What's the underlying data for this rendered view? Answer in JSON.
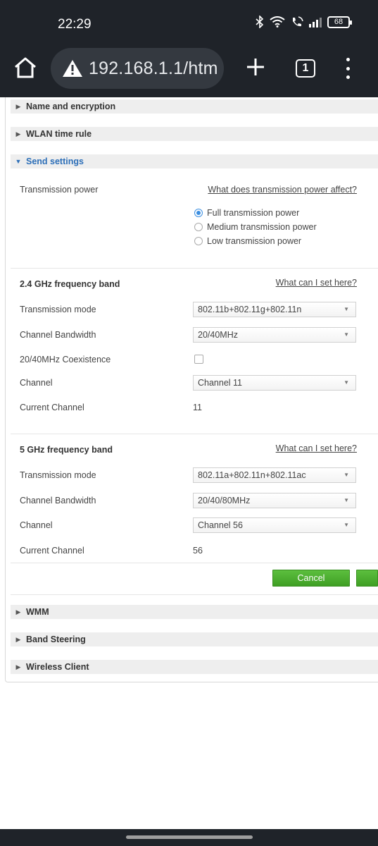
{
  "status_bar": {
    "time": "22:29",
    "battery": "68",
    "icons": [
      "bluetooth-icon",
      "wifi-icon",
      "volte-call-icon",
      "signal-icon",
      "battery-icon"
    ]
  },
  "browser": {
    "url": "192.168.1.1/htm",
    "tab_count": "1",
    "icons": [
      "home-icon",
      "warning-icon",
      "plus-icon",
      "tab-switcher-icon",
      "more-vert-icon"
    ]
  },
  "sections": {
    "name_encryption": "Name and encryption",
    "wlan_time_rule": "WLAN time rule",
    "send_settings": "Send settings",
    "wmm": "WMM",
    "band_steering": "Band Steering",
    "wireless_client": "Wireless Client"
  },
  "send_settings": {
    "transmission_power_label": "Transmission power",
    "transmission_power_link": "What does transmission power affect?",
    "power_options": [
      {
        "label": "Full transmission power",
        "selected": true
      },
      {
        "label": "Medium transmission power",
        "selected": false
      },
      {
        "label": "Low transmission power",
        "selected": false
      }
    ]
  },
  "band_24": {
    "title": "2.4 GHz frequency band",
    "help_link": "What can I set here?",
    "mode_label": "Transmission mode",
    "mode_value": "802.11b+802.11g+802.11n",
    "bandwidth_label": "Channel Bandwidth",
    "bandwidth_value": "20/40MHz",
    "coexistence_label": "20/40MHz Coexistence",
    "coexistence_checked": false,
    "channel_label": "Channel",
    "channel_value": "Channel 11",
    "current_channel_label": "Current Channel",
    "current_channel_value": "11"
  },
  "band_5": {
    "title": "5 GHz frequency band",
    "help_link": "What can I set here?",
    "mode_label": "Transmission mode",
    "mode_value": "802.11a+802.11n+802.11ac",
    "bandwidth_label": "Channel Bandwidth",
    "bandwidth_value": "20/40/80MHz",
    "channel_label": "Channel",
    "channel_value": "Channel 56",
    "current_channel_label": "Current Channel",
    "current_channel_value": "56"
  },
  "actions": {
    "cancel_label": "Cancel",
    "apply_label": ""
  },
  "colors": {
    "chrome_bg": "#1f2329",
    "urlbar_bg": "#343940",
    "section_header_bg": "#eeeeee",
    "link_blue": "#2d6fb8",
    "button_green": "#4caf30",
    "radio_selected": "#3b8ee0"
  }
}
